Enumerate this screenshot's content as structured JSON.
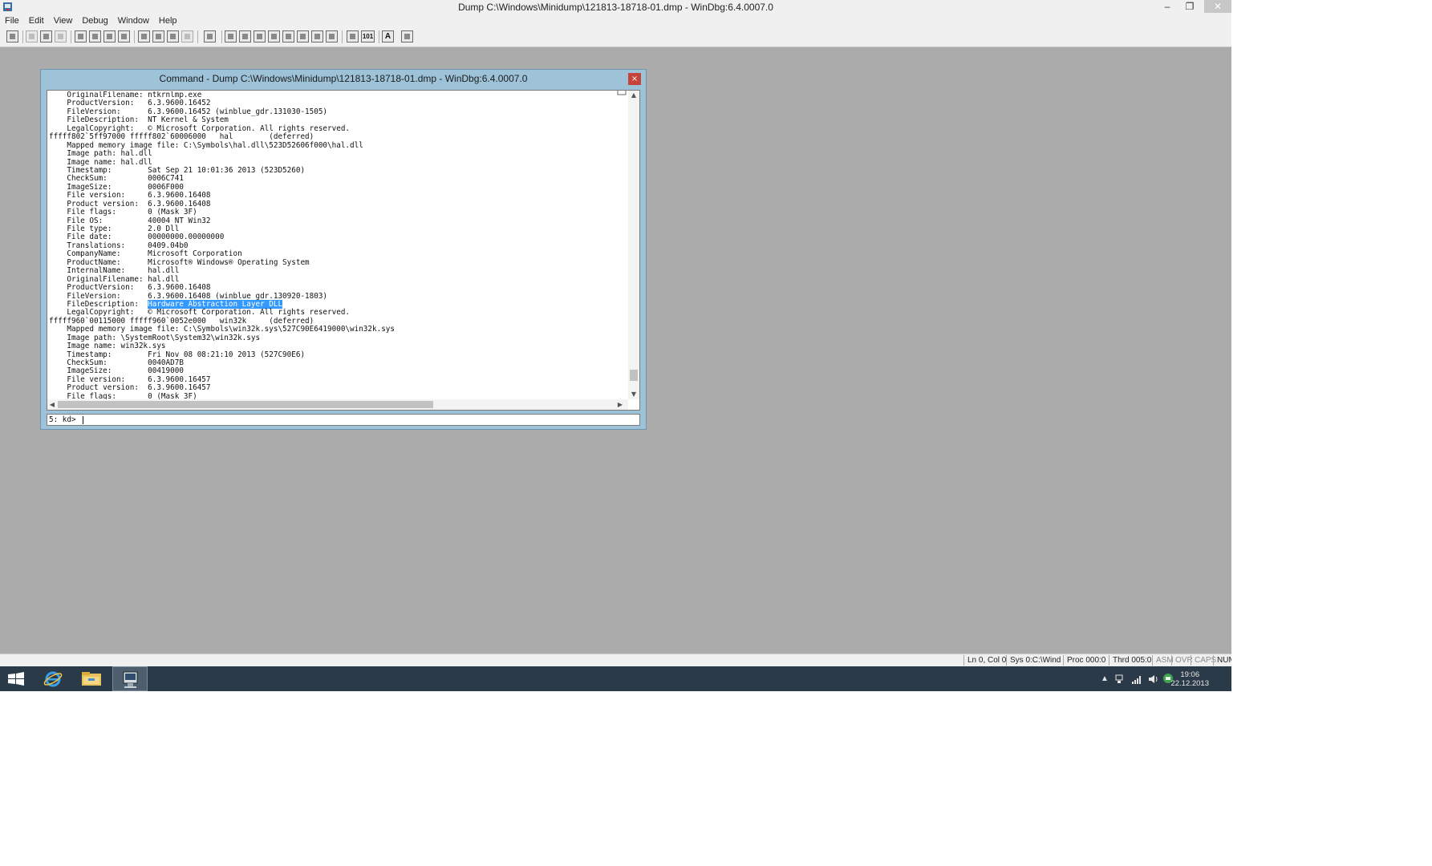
{
  "app": {
    "title": "Dump C:\\Windows\\Minidump\\121813-18718-01.dmp - WinDbg:6.4.0007.0",
    "window_controls": {
      "minimize": "–",
      "restore": "❐",
      "close": "✕"
    }
  },
  "menu": [
    "File",
    "Edit",
    "View",
    "Debug",
    "Window",
    "Help"
  ],
  "toolbar": {
    "icons": [
      "open-icon",
      "cut-icon",
      "copy-icon",
      "paste-icon",
      "go-icon",
      "restart-icon",
      "stop-debugging-icon",
      "break-icon",
      "step-into-icon",
      "step-over-icon",
      "step-out-icon",
      "run-to-cursor-icon",
      "hand-icon",
      "command-window-icon",
      "watch-window-icon",
      "locals-window-icon",
      "registers-window-icon",
      "memory-window-icon",
      "call-stack-icon",
      "disassembly-window-icon",
      "scratch-pad-icon",
      "source-mode-icon",
      "hex-mode-icon",
      "font-icon",
      "options-icon"
    ],
    "hex_label": "101",
    "font_label": "A"
  },
  "command_window": {
    "title": "Command - Dump C:\\Windows\\Minidump\\121813-18718-01.dmp - WinDbg:6.4.0007.0",
    "close": "×",
    "output_lines": [
      "    OriginalFilename: ntkrnlmp.exe",
      "    ProductVersion:   6.3.9600.16452",
      "    FileVersion:      6.3.9600.16452 (winblue_gdr.131030-1505)",
      "    FileDescription:  NT Kernel & System",
      "    LegalCopyright:   © Microsoft Corporation. All rights reserved.",
      "fffff802`5ff97000 fffff802`60006000   hal        (deferred)",
      "    Mapped memory image file: C:\\Symbols\\hal.dll\\523D52606f000\\hal.dll",
      "    Image path: hal.dll",
      "    Image name: hal.dll",
      "    Timestamp:        Sat Sep 21 10:01:36 2013 (523D5260)",
      "    CheckSum:         0006C741",
      "    ImageSize:        0006F000",
      "    File version:     6.3.9600.16408",
      "    Product version:  6.3.9600.16408",
      "    File flags:       0 (Mask 3F)",
      "    File OS:          40004 NT Win32",
      "    File type:        2.0 Dll",
      "    File date:        00000000.00000000",
      "    Translations:     0409.04b0",
      "    CompanyName:      Microsoft Corporation",
      "    ProductName:      Microsoft® Windows® Operating System",
      "    InternalName:     hal.dll",
      "    OriginalFilename: hal.dll",
      "    ProductVersion:   6.3.9600.16408",
      "    FileVersion:      6.3.9600.16408 (winblue_gdr.130920-1803)",
      "    FileDescription:  ",
      "    LegalCopyright:   © Microsoft Corporation. All rights reserved.",
      "fffff960`00115000 fffff960`0052e000   win32k     (deferred)",
      "    Mapped memory image file: C:\\Symbols\\win32k.sys\\527C90E6419000\\win32k.sys",
      "    Image path: \\SystemRoot\\System32\\win32k.sys",
      "    Image name: win32k.sys",
      "    Timestamp:        Fri Nov 08 08:21:10 2013 (527C90E6)",
      "    CheckSum:         0040AD7B",
      "    ImageSize:        00419000",
      "    File version:     6.3.9600.16457",
      "    Product version:  6.3.9600.16457",
      "    File flags:       0 (Mask 3F)"
    ],
    "highlighted_text": "Hardware Abstraction Layer DLL",
    "prompt": "5: kd>",
    "input_value": ""
  },
  "statusbar": {
    "position": "Ln 0, Col 0",
    "system": "Sys 0:C:\\Wind",
    "process": "Proc 000:0",
    "thread": "Thrd 005:0",
    "asm": "ASM",
    "ovr": "OVR",
    "caps": "CAPS",
    "num": "NUM"
  },
  "taskbar": {
    "buttons": [
      "start-button",
      "internet-explorer-button",
      "file-explorer-button",
      "windbg-button"
    ],
    "tray": {
      "chevron": "▲"
    },
    "clock_time": "19:06",
    "clock_date": "22.12.2013"
  }
}
